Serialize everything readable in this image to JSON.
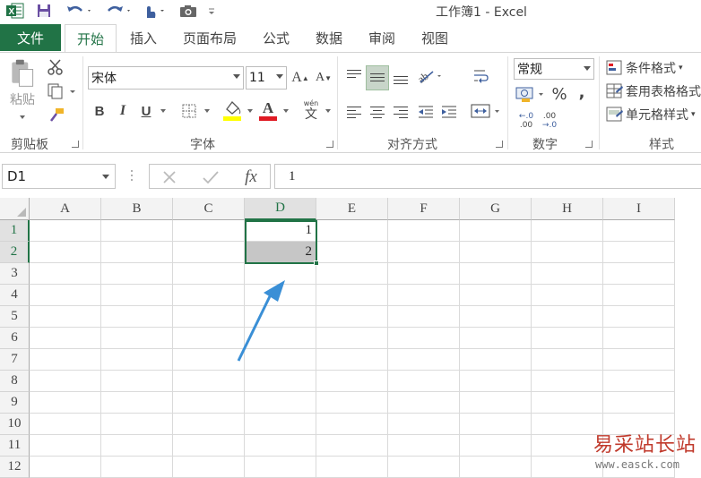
{
  "window": {
    "title": "工作簿1 - Excel"
  },
  "quick_access": {
    "icons": [
      "excel-logo-icon",
      "save-icon",
      "undo-icon",
      "redo-icon",
      "touch-mode-icon",
      "camera-icon",
      "customize-qat-icon"
    ]
  },
  "tabs": [
    {
      "label": "文件"
    },
    {
      "label": "开始"
    },
    {
      "label": "插入"
    },
    {
      "label": "页面布局"
    },
    {
      "label": "公式"
    },
    {
      "label": "数据"
    },
    {
      "label": "审阅"
    },
    {
      "label": "视图"
    }
  ],
  "active_tab": "开始",
  "ribbon": {
    "clipboard": {
      "label": "剪贴板",
      "paste_label": "粘贴"
    },
    "font": {
      "label": "字体",
      "font_name": "宋体",
      "font_size": "11",
      "bold": "B",
      "italic": "I",
      "underline": "U",
      "wen": "wén",
      "wen_char": "文",
      "font_color_letter": "A",
      "grow_letter": "A",
      "shrink_letter": "A"
    },
    "alignment": {
      "label": "对齐方式"
    },
    "number": {
      "label": "数字",
      "format": "常规",
      "percent": "%",
      "comma": ",",
      "inc_decimal_top": "←.0",
      "inc_decimal_bottom": ".00",
      "dec_decimal_top": ".00",
      "dec_decimal_bottom": "→.0"
    },
    "styles": {
      "label": "样式",
      "conditional_formatting": "条件格式",
      "format_as_table": "套用表格格式",
      "cell_styles": "单元格样式"
    }
  },
  "formula_bar": {
    "name_box": "D1",
    "value": "1",
    "fx": "fx"
  },
  "grid": {
    "columns": [
      "A",
      "B",
      "C",
      "D",
      "E",
      "F",
      "G",
      "H",
      "I"
    ],
    "rows": [
      "1",
      "2",
      "3",
      "4",
      "5",
      "6",
      "7",
      "8",
      "9",
      "10",
      "11",
      "12"
    ],
    "cells": {
      "D1": "1",
      "D2": "2"
    },
    "selected_column": "D",
    "selected_rows": [
      "1",
      "2"
    ],
    "selection_color": "#217346"
  },
  "colors": {
    "accent": "#217346",
    "arrow": "#3a8fd6"
  },
  "watermark": {
    "text": "易采站长站",
    "url": "www.easck.com"
  }
}
